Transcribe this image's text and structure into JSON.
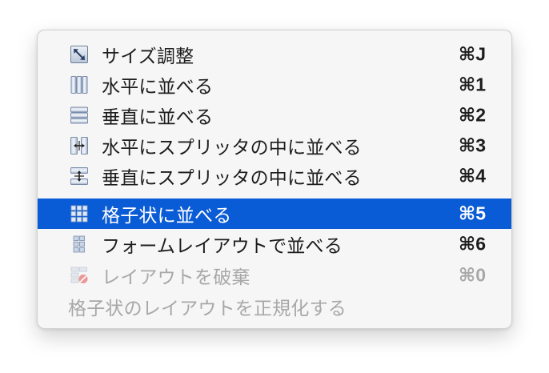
{
  "menu": {
    "items": [
      {
        "label": "サイズ調整",
        "shortcut": "⌘J",
        "icon": "resize-icon",
        "state": "normal"
      },
      {
        "label": "水平に並べる",
        "shortcut": "⌘1",
        "icon": "horizontal-layout-icon",
        "state": "normal"
      },
      {
        "label": "垂直に並べる",
        "shortcut": "⌘2",
        "icon": "vertical-layout-icon",
        "state": "normal"
      },
      {
        "label": "水平にスプリッタの中に並べる",
        "shortcut": "⌘3",
        "icon": "horizontal-splitter-icon",
        "state": "normal"
      },
      {
        "label": "垂直にスプリッタの中に並べる",
        "shortcut": "⌘4",
        "icon": "vertical-splitter-icon",
        "state": "normal"
      },
      {
        "label": "格子状に並べる",
        "shortcut": "⌘5",
        "icon": "grid-layout-icon",
        "state": "selected"
      },
      {
        "label": "フォームレイアウトで並べる",
        "shortcut": "⌘6",
        "icon": "form-layout-icon",
        "state": "normal"
      },
      {
        "label": "レイアウトを破棄",
        "shortcut": "⌘0",
        "icon": "break-layout-icon",
        "state": "disabled"
      },
      {
        "label": "格子状のレイアウトを正規化する",
        "shortcut": "",
        "icon": "",
        "state": "disabled"
      }
    ]
  },
  "colors": {
    "selection": "#0a5bd6",
    "text": "#1d1d1d",
    "disabled_text": "#a8a8a8",
    "menu_background": "#f6f6f6"
  }
}
